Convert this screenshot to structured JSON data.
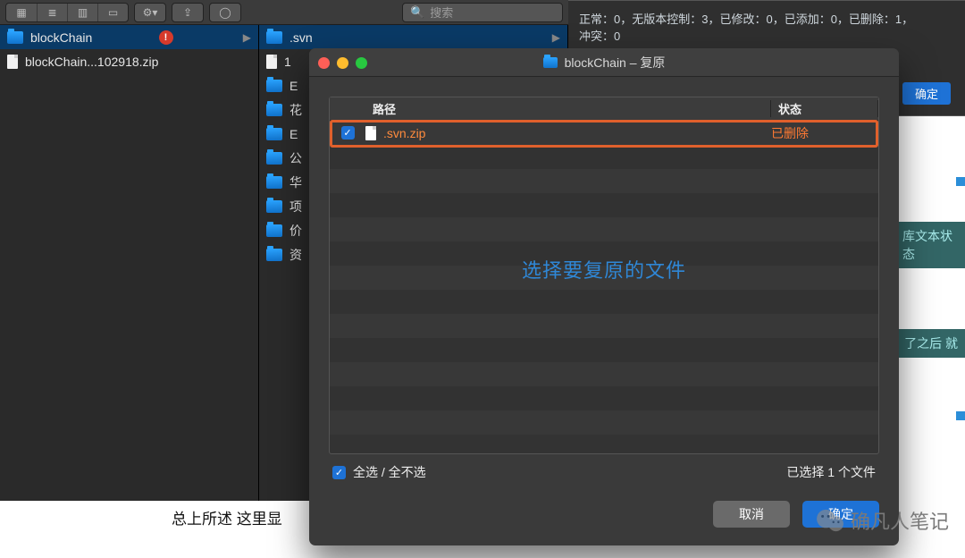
{
  "finder": {
    "search_placeholder": "搜索",
    "col0": {
      "items": [
        {
          "name": "blockChain",
          "type": "folder",
          "selected": true,
          "alert": true,
          "has_children": true
        },
        {
          "name": "blockChain...102918.zip",
          "type": "file"
        }
      ]
    },
    "col1": {
      "header": ".svn",
      "items": [
        {
          "name": "1",
          "type": "file"
        },
        {
          "name": "E",
          "type": "folder"
        },
        {
          "name": "花",
          "type": "folder"
        },
        {
          "name": "E",
          "type": "folder"
        },
        {
          "name": "公",
          "type": "folder"
        },
        {
          "name": "华",
          "type": "folder"
        },
        {
          "name": "项",
          "type": "folder"
        },
        {
          "name": "价",
          "type": "folder"
        },
        {
          "name": "资",
          "type": "folder"
        }
      ]
    }
  },
  "svn_status": {
    "line1": "正常：0，无版本控制：3，已修改：0，已添加：0，已删除：1，",
    "line2": "冲突：0",
    "ok": "确定"
  },
  "side": {
    "chip1": "库文本状态",
    "chip2": "了之后 就"
  },
  "modal": {
    "title": "blockChain – 复原",
    "columns": {
      "path": "路径",
      "status": "状态"
    },
    "rows": [
      {
        "checked": true,
        "filename": ".svn.zip",
        "status": "已删除"
      }
    ],
    "hint": "选择要复原的文件",
    "select_all_label": "全选 / 全不选",
    "select_all_checked": true,
    "selected_count_label": "已选择 1 个文件",
    "cancel": "取消",
    "confirm": "确定"
  },
  "bottom_text": "总上所述 这里显",
  "watermark": "确凡人笔记"
}
